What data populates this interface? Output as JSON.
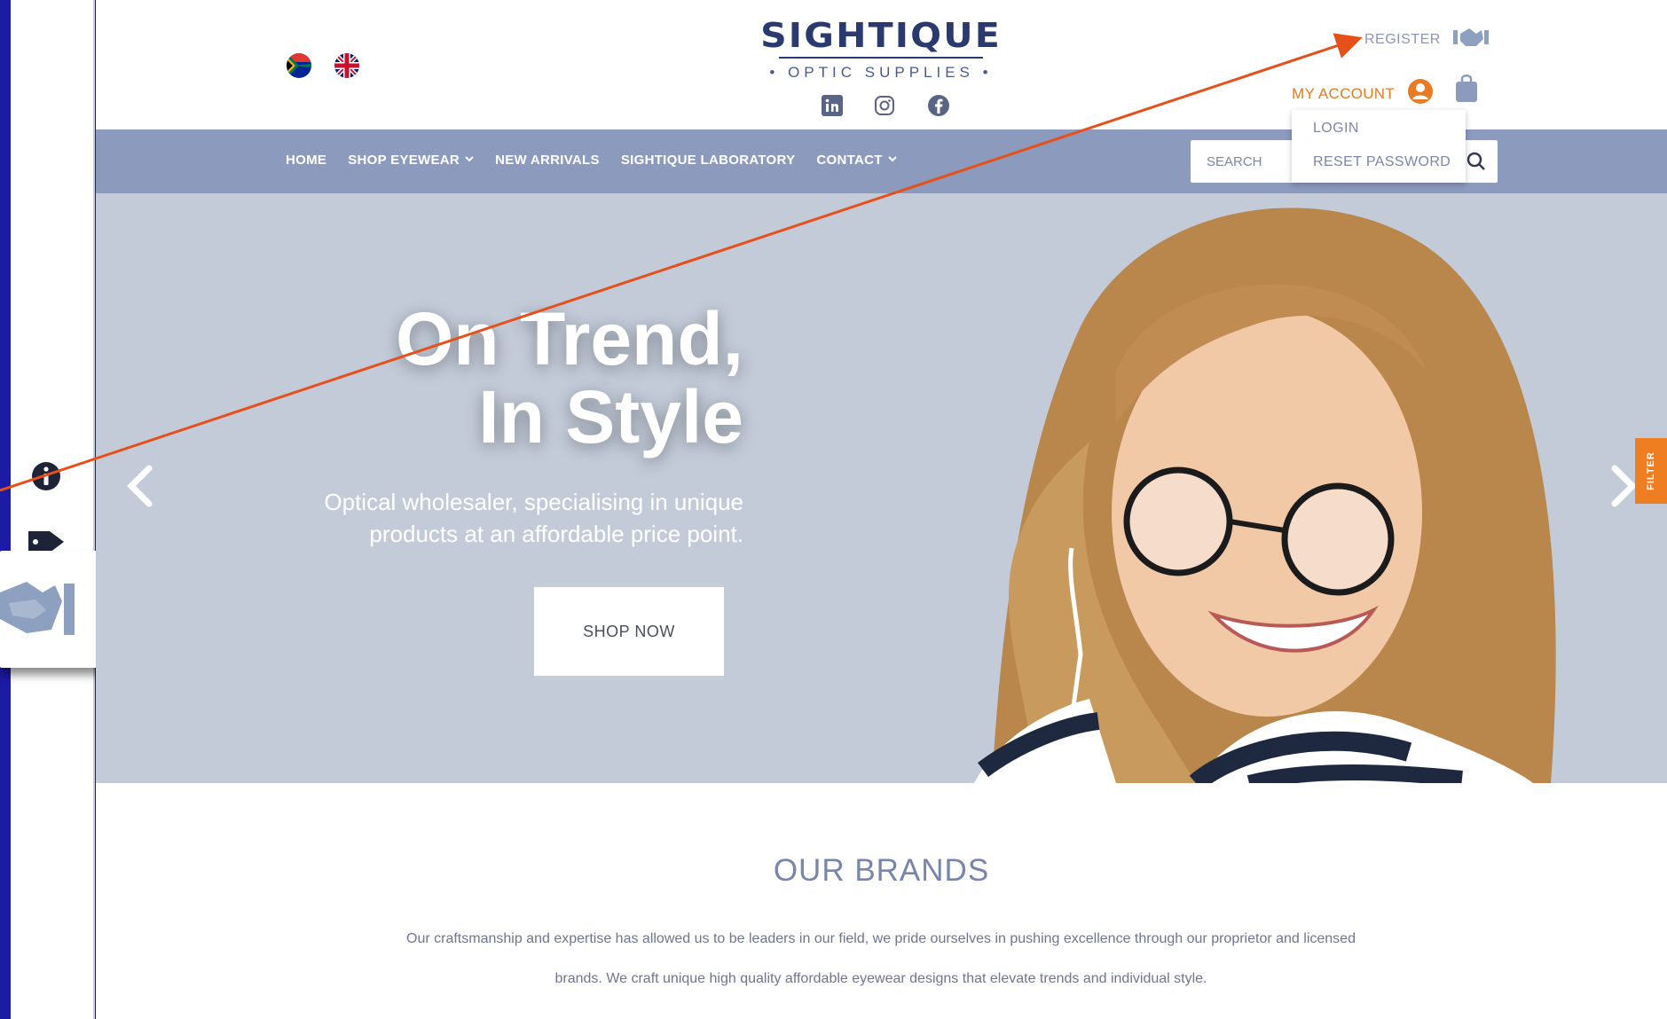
{
  "header": {
    "logo_main": "SIGHTIQUE",
    "logo_sub": "• OPTIC SUPPLIES •",
    "register_label": "REGISTER",
    "my_account_label": "MY ACCOUNT"
  },
  "account_menu": {
    "items": [
      "LOGIN",
      "RESET PASSWORD"
    ]
  },
  "nav": {
    "items": [
      {
        "label": "HOME",
        "has_dropdown": false
      },
      {
        "label": "SHOP EYEWEAR",
        "has_dropdown": true
      },
      {
        "label": "NEW ARRIVALS",
        "has_dropdown": false
      },
      {
        "label": "SIGHTIQUE LABORATORY",
        "has_dropdown": false
      },
      {
        "label": "CONTACT",
        "has_dropdown": true
      }
    ]
  },
  "search": {
    "placeholder": "SEARCH"
  },
  "hero": {
    "title_line1": "On Trend,",
    "title_line2": "In Style",
    "subtitle_line1": "Optical wholesaler, specialising in unique",
    "subtitle_line2": "products at an affordable price point.",
    "button_label": "SHOP NOW"
  },
  "filter_tab": {
    "label": "FILTER"
  },
  "brands": {
    "title": "OUR BRANDS",
    "text_line1": "Our craftsmanship and expertise has allowed us to be leaders in our field, we pride ourselves in pushing excellence through our proprietor and licensed",
    "text_line2": "brands. We craft unique high quality affordable eyewear designs  that elevate trends and individual style."
  },
  "colors": {
    "frame_background": "#1d1aa6",
    "nav_background": "#8c9abd",
    "accent_orange": "#e87b23",
    "pointer_arrow": "#e5501b",
    "hero_background": "#c3cbd9"
  },
  "icons": {
    "side": [
      "info-icon",
      "tag-icon"
    ],
    "zoom_preview": "handshake-icon",
    "social": [
      "linkedin-icon",
      "instagram-icon",
      "facebook-icon"
    ],
    "flags": [
      "south-africa-flag-icon",
      "uk-flag-icon"
    ]
  }
}
